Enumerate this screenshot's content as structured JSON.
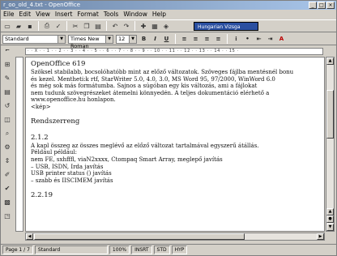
{
  "window": {
    "title": "r_oo_old_4.txt - OpenOffice",
    "controls": [
      "_",
      "□",
      "×"
    ]
  },
  "menu": [
    "Eile",
    "Edit",
    "View",
    "Insert",
    "Format",
    "Tools",
    "Window",
    "Help"
  ],
  "toolbar": {
    "url_box": "Hungarian Vizsga"
  },
  "format_bar": {
    "style": "Standard",
    "font": "Times New Roman",
    "size": "12"
  },
  "ruler_text": "· · X · · 1 · · 2 · · 3 · · 4 · · 5 · · 6 · · 7 · · 8 · · 9 · · 10 · · 11 · · 12 · · 13 · · 14 · · 15 ·",
  "document": {
    "lines": [
      "OpenOffice 619",
      "Szöksel stabilabb, bocsolóhatóbb mint az előző változatok. Szöveges fájlba mentésnél bonu",
      "és kezel. Mentheti:k rtf, StarWriter 5.0, 4.0, 3.0, MS Word 95, 97/2000, WinWord 6.0",
      "és még sok más formátumba. Sajnos a súgóban egy kis változás, ami a fájlokat",
      "nem tudunk szövegrészeket átemelni könnyedén. A teljes dokumentáció elérhető a",
      "www.openoffice.hu honlapon.",
      "<kép>",
      "",
      "Rendszerreng",
      "",
      "2.1.2",
      "A kapl összeg az összes meglévő az előző változat tartalmával egyszerű átállás.",
      "Például például:",
      "    nem FE, sxhfffl, viaN2xxxx, Ctompaq Smart Array, meglepő javítás",
      "– USB, ISDN, Irda javítás",
      "    USB printer status () javítás",
      "– szabb és IISCIMEM javítás",
      "",
      "2.2.19"
    ]
  },
  "status": {
    "page": "Page 1 / 7",
    "style": "Standard",
    "zoom": "100%",
    "mode": "INSRT",
    "std": "STD",
    "hyp": "HYP"
  }
}
